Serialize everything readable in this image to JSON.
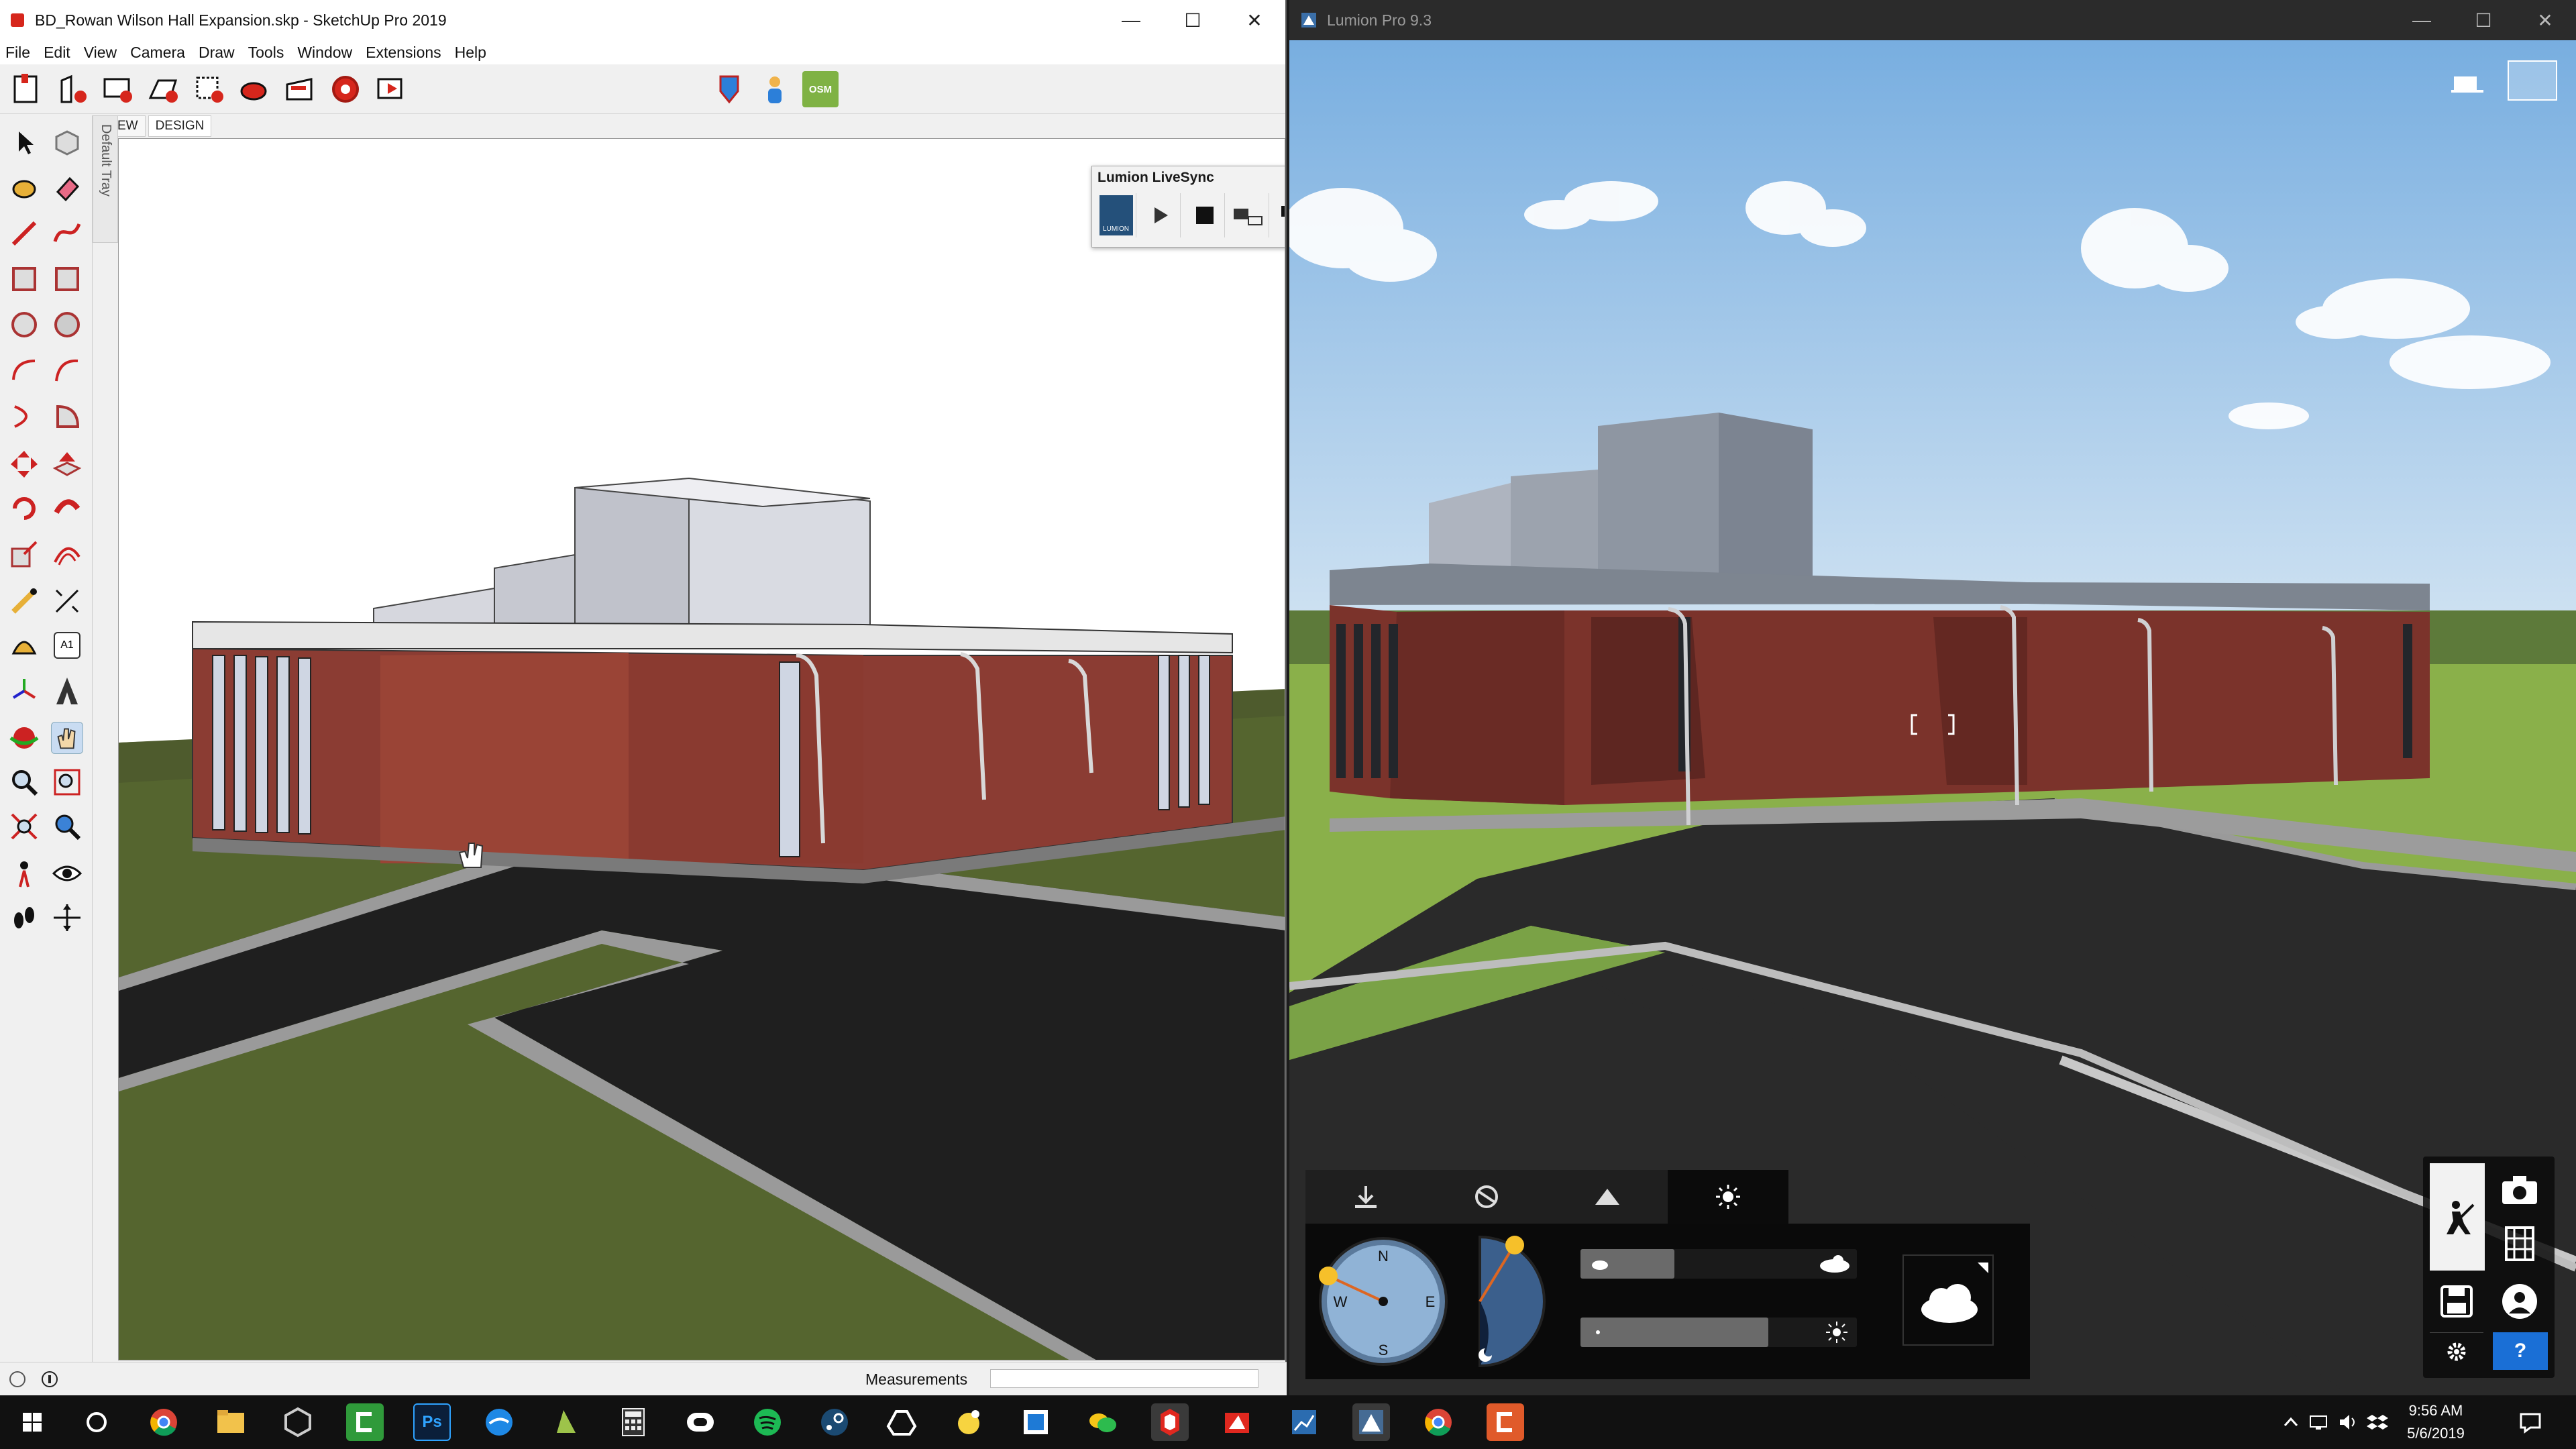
{
  "sketchup": {
    "title": "BD_Rowan Wilson Hall Expansion.skp - SketchUp Pro 2019",
    "menu": [
      "File",
      "Edit",
      "View",
      "Camera",
      "Draw",
      "Tools",
      "Window",
      "Extensions",
      "Help"
    ],
    "tabs": [
      "VIEW",
      "DESIGN"
    ],
    "tray_label": "Default Tray",
    "livesync": {
      "title": "Lumion LiveSync",
      "logo_text": "LUMION"
    },
    "text_tool_label": "A1",
    "osm_label": "OSM",
    "status": {
      "measurements_label": "Measurements",
      "measurements_value": ""
    },
    "win_controls": [
      "—",
      "☐",
      "✕"
    ]
  },
  "lumion": {
    "title": "Lumion Pro 9.3",
    "win_controls": [
      "—",
      "☐",
      "✕"
    ],
    "weather": {
      "tabs": [
        "import-icon",
        "materials-icon",
        "landscape-icon",
        "sun-icon"
      ],
      "active_tab": 3,
      "compass": {
        "n": "N",
        "e": "E",
        "s": "S",
        "w": "W"
      },
      "cloud_amount": 0.34,
      "sun_brightness": 0.68
    },
    "modes": [
      "build-mode",
      "photo-mode",
      "save-mode",
      "movie-mode",
      "settings",
      "360-panorama",
      "help"
    ],
    "help_label": "?"
  },
  "taskbar": {
    "time": "9:56 AM",
    "date": "5/6/2019",
    "apps": [
      "start",
      "cortana",
      "chrome",
      "file-explorer",
      "unity",
      "camtasia",
      "photoshop",
      "sync",
      "sketchup-layout",
      "calculator",
      "oculus",
      "spotify",
      "steam",
      "google-drive",
      "sticky-notes",
      "snip",
      "wechat",
      "sketchup",
      "layout",
      "powerbi",
      "lumion",
      "chrome-2",
      "camtasia-2"
    ],
    "ps_label": "Ps"
  },
  "colors": {
    "brick": "#8b3c33",
    "sky": "#9ec4e6",
    "grass": "#6b8a32",
    "asphalt": "#2a2a2a",
    "lumion_blue": "#1a6fd6"
  }
}
